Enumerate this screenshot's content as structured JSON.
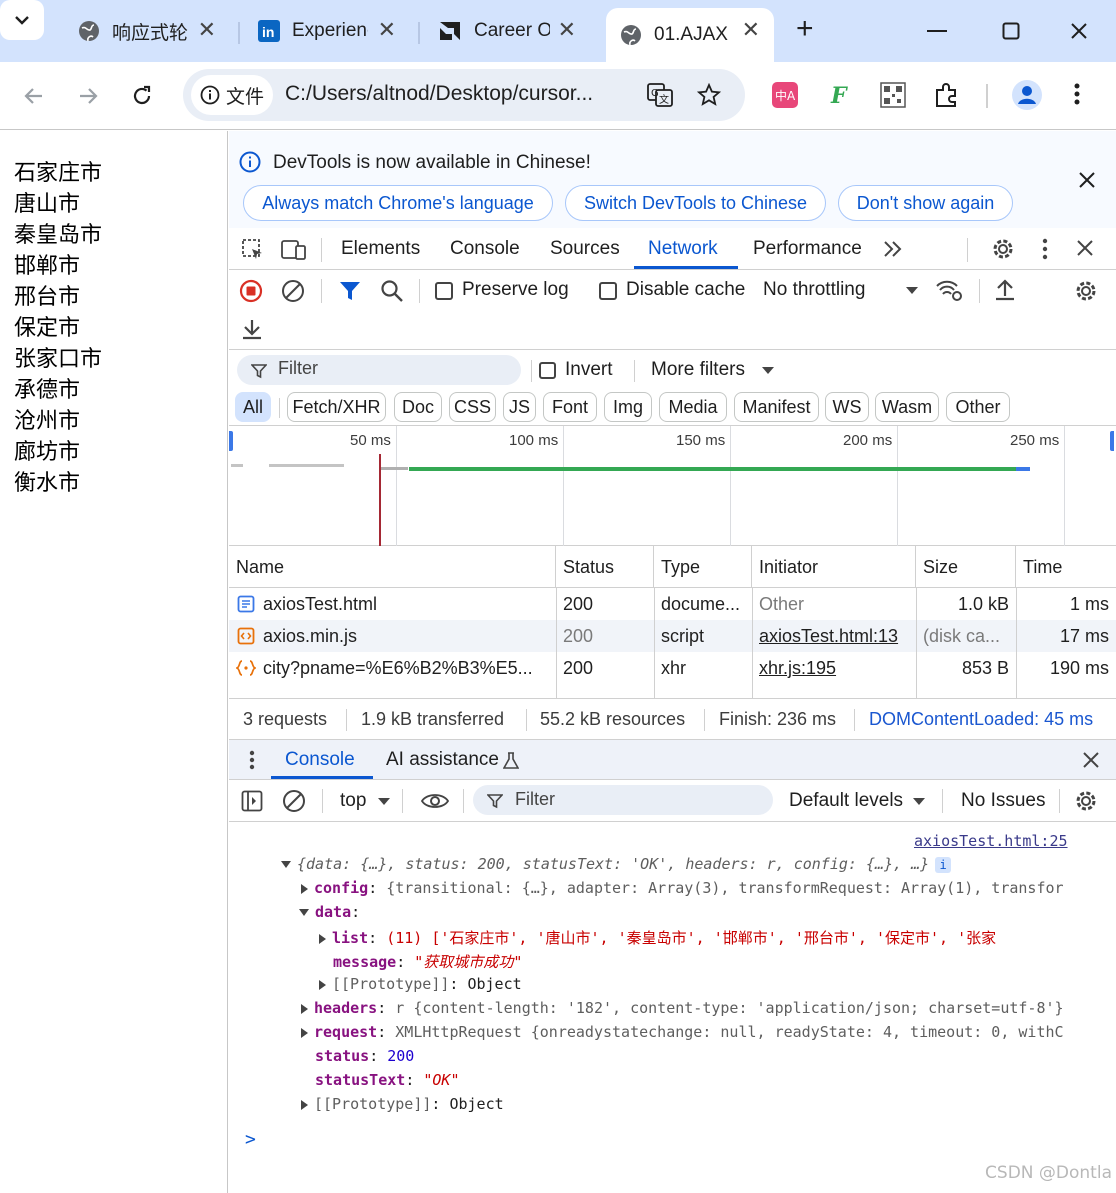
{
  "browser": {
    "tabs": [
      {
        "title": "响应式轮播",
        "icon": "globe-icon"
      },
      {
        "title": "Experience",
        "icon": "linkedin-icon"
      },
      {
        "title": "Career O",
        "icon": "amd-icon"
      },
      {
        "title": "01.AJAX",
        "icon": "globe-icon"
      }
    ],
    "new_tab_symbol": "+",
    "address_chip": "文件",
    "url": "C:/Users/altnod/Desktop/cursor...",
    "translate_icon": "translate-icon",
    "star_icon": "star-icon",
    "extension_icons": [
      "translate-extension-icon",
      "f-extension-icon",
      "qr-extension-icon",
      "puzzle-icon"
    ],
    "profile_icon": "profile-icon"
  },
  "page": {
    "cities": [
      "石家庄市",
      "唐山市",
      "秦皇岛市",
      "邯郸市",
      "邢台市",
      "保定市",
      "张家口市",
      "承德市",
      "沧州市",
      "廊坊市",
      "衡水市"
    ]
  },
  "devtools": {
    "infobar": {
      "message": "DevTools is now available in Chinese!",
      "buttons": [
        "Always match Chrome's language",
        "Switch DevTools to Chinese",
        "Don't show again"
      ]
    },
    "tabs": [
      "Elements",
      "Console",
      "Sources",
      "Network",
      "Performance"
    ],
    "active_tab": "Network",
    "network": {
      "preserve_log": "Preserve log",
      "disable_cache": "Disable cache",
      "throttling": "No throttling",
      "filter_placeholder": "Filter",
      "invert": "Invert",
      "more_filters": "More filters",
      "type_filters": [
        "All",
        "Fetch/XHR",
        "Doc",
        "CSS",
        "JS",
        "Font",
        "Img",
        "Media",
        "Manifest",
        "WS",
        "Wasm",
        "Other"
      ],
      "timeline_ticks": [
        "50 ms",
        "100 ms",
        "150 ms",
        "200 ms",
        "250 ms"
      ],
      "columns": [
        "Name",
        "Status",
        "Type",
        "Initiator",
        "Size",
        "Time"
      ],
      "rows": [
        {
          "name": "axiosTest.html",
          "status": "200",
          "type": "docume...",
          "initiator": "Other",
          "size": "1.0 kB",
          "time": "1 ms",
          "icon": "document-icon"
        },
        {
          "name": "axios.min.js",
          "status": "200",
          "type": "script",
          "initiator": "axiosTest.html:13",
          "size": "(disk ca...",
          "time": "17 ms",
          "icon": "script-icon"
        },
        {
          "name": "city?pname=%E6%B2%B3%E5...",
          "status": "200",
          "type": "xhr",
          "initiator": "xhr.js:195",
          "size": "853 B",
          "time": "190 ms",
          "icon": "xhr-icon"
        }
      ],
      "summary": {
        "requests": "3 requests",
        "transferred": "1.9 kB transferred",
        "resources": "55.2 kB resources",
        "finish": "Finish: 236 ms",
        "dcl": "DOMContentLoaded: 45 ms"
      }
    },
    "drawer": {
      "tabs": [
        "Console",
        "AI assistance"
      ],
      "context": "top",
      "filter_placeholder": "Filter",
      "levels": "Default levels",
      "issues": "No Issues"
    },
    "console": {
      "source": "axiosTest.html:25",
      "summary_line": "{data: {…}, status: 200, statusText: 'OK', headers: r, config: {…}, …}",
      "config_line": "{transitional: {…}, adapter: Array(3), transformRequest: Array(1), transfor",
      "list_preview": "(11) ['石家庄市', '唐山市', '秦皇岛市', '邯郸市', '邢台市', '保定市', '张家",
      "message_value": "\"获取城市成功\"",
      "prototype": "[[Prototype]]",
      "object": "Object",
      "headers_line": "r {content-length: '182', content-type: 'application/json; charset=utf-8'}",
      "request_line": "XMLHttpRequest {onreadystatechange: null, readyState: 4, timeout: 0, withC",
      "status_value": "200",
      "status_text_value": "\"OK\"",
      "keys": {
        "config": "config",
        "data": "data",
        "list": "list",
        "message": "message",
        "headers": "headers",
        "request": "request",
        "status": "status",
        "statusText": "statusText"
      },
      "prompt": ">"
    },
    "watermark": "CSDN @Dontla"
  }
}
